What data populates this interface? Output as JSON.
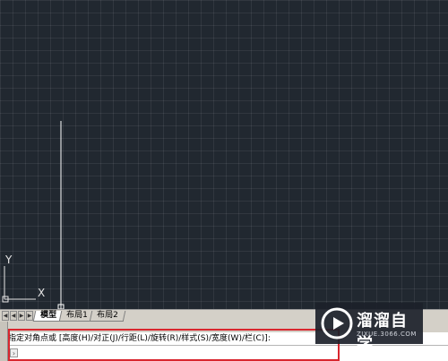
{
  "canvas": {
    "background_color": "#212830",
    "ucs_y_label": "Y",
    "ucs_x_label": "X"
  },
  "layout_tabs": {
    "nav_icons": [
      "first-tab-icon",
      "prev-tab-icon",
      "next-tab-icon",
      "last-tab-icon"
    ],
    "tabs": [
      {
        "label": "模型",
        "active": true
      },
      {
        "label": "布局1",
        "active": false
      },
      {
        "label": "布局2",
        "active": false
      }
    ]
  },
  "command_window": {
    "history_line": "指定对角点或 [高度(H)/对正(J)/行距(L)/旋转(R)/样式(S)/宽度(W)/栏(C)]:",
    "input_value": "",
    "highlight_color": "#d9262e"
  },
  "watermark": {
    "brand": "溜溜自学",
    "url": "ZIXUE.3066.COM"
  }
}
